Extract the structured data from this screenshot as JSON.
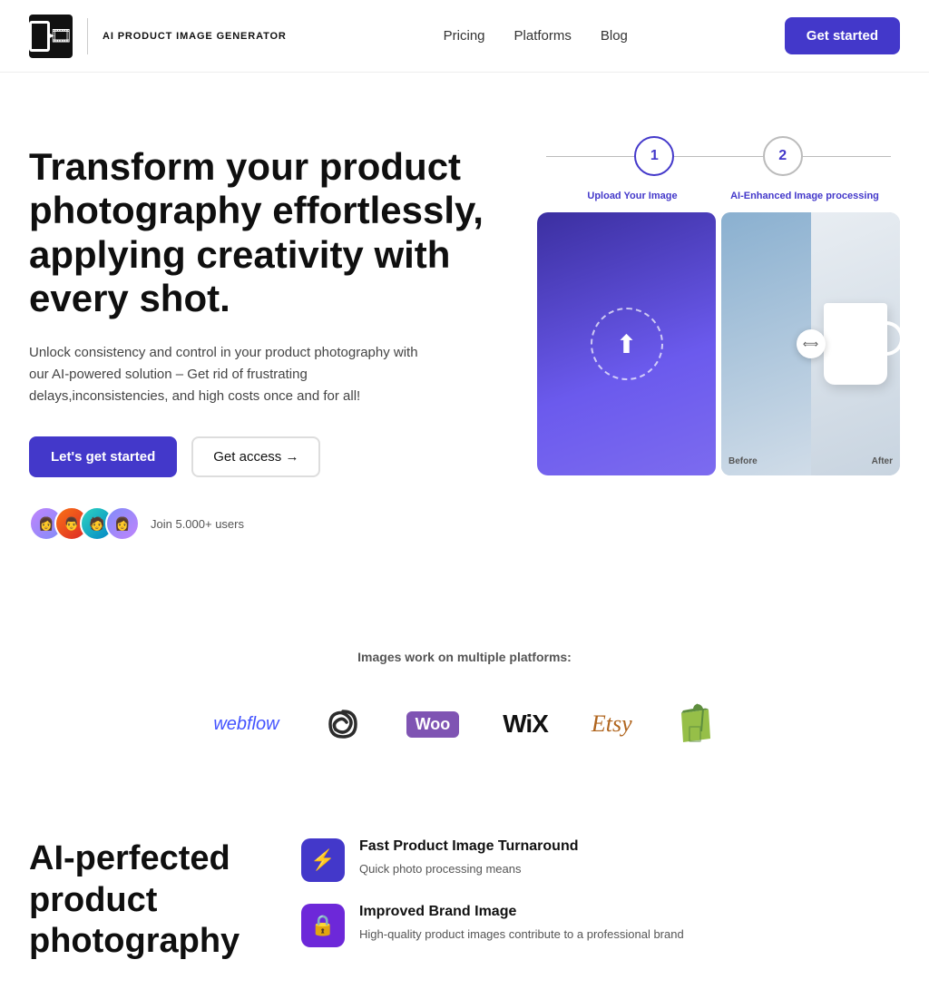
{
  "nav": {
    "brand": "AI PRODUCT IMAGE GENERATOR",
    "links": [
      "Pricing",
      "Platforms",
      "Blog"
    ],
    "cta": "Get started"
  },
  "hero": {
    "title": "Transform your product photography effortlessly, applying creativity with every shot.",
    "subtitle": "Unlock consistency and control in your product photography with our AI-powered solution – Get rid of frustrating delays,inconsistencies, and high costs once and for all!",
    "btn_primary": "Let's get started",
    "btn_secondary": "Get access →",
    "users_label": "Join 5.000+ users",
    "step1_label": "Upload Your Image",
    "step2_label": "AI-Enhanced Image processing",
    "step1_num": "1",
    "step2_num": "2",
    "before_label": "Before",
    "after_label": "After"
  },
  "platforms": {
    "title": "Images work on multiple platforms:",
    "logos": [
      "webflow",
      "squarespace",
      "WooCommerce",
      "WiX",
      "Etsy",
      "Shopify"
    ]
  },
  "features": {
    "heading": "AI-perfected product photography",
    "cards": [
      {
        "icon": "⚡",
        "icon_type": "bolt",
        "title": "Fast Product Image Turnaround",
        "description": "Quick photo processing means"
      },
      {
        "icon": "🔒",
        "icon_type": "lock",
        "title": "Improved Brand Image",
        "description": "High-quality product images contribute to a professional brand"
      }
    ]
  }
}
